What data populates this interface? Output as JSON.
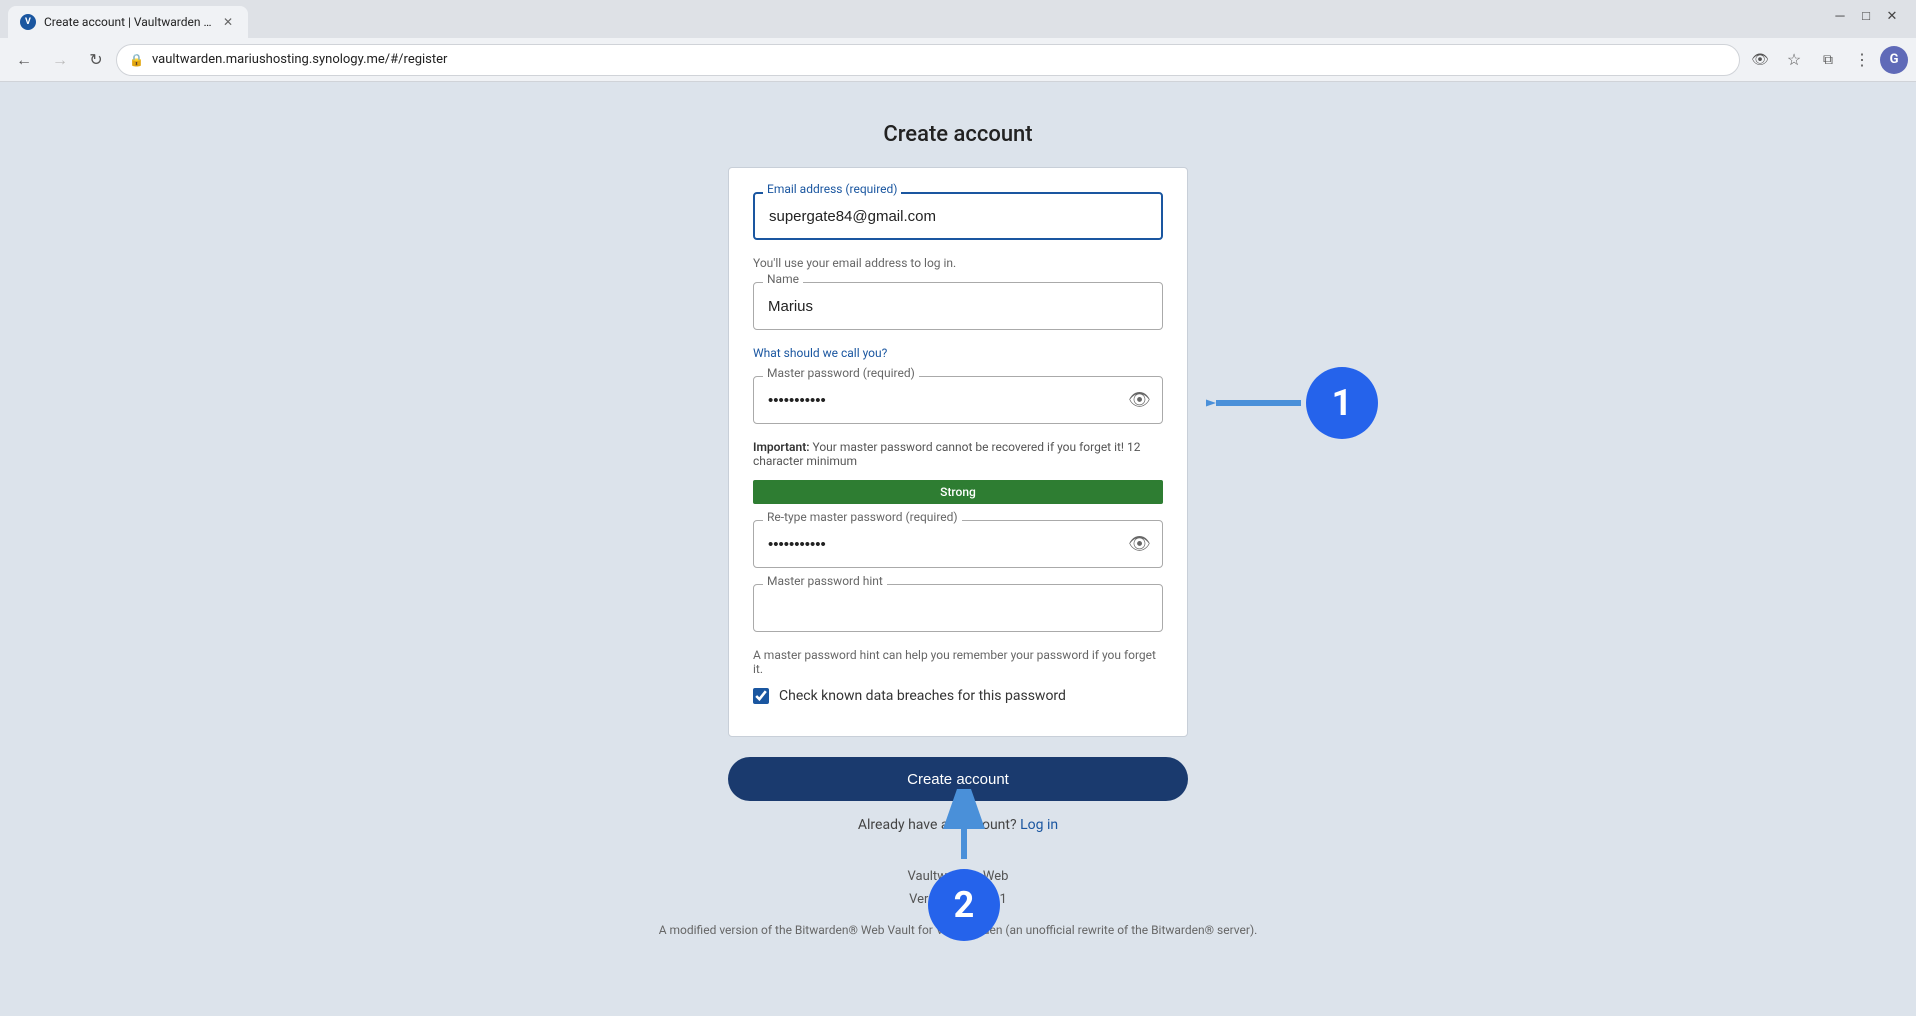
{
  "browser": {
    "tab_title": "Create account | Vaultwarden W",
    "tab_favicon": "V",
    "url": "vaultwarden.mariushosting.synology.me/#/register",
    "window_controls": {
      "minimize": "─",
      "restore": "□",
      "close": "✕"
    }
  },
  "nav": {
    "back_disabled": false,
    "forward_disabled": true,
    "profile_letter": "G"
  },
  "page": {
    "title": "Create account",
    "form": {
      "email_label": "Email address (required)",
      "email_value": "supergate84@gmail.com",
      "email_helper": "You'll use your email address to log in.",
      "name_label": "Name",
      "name_value": "Marius",
      "name_helper": "What should we call you?",
      "master_password_label": "Master password (required)",
      "master_password_value": "············",
      "master_password_warning": "Your master password cannot be recovered if you forget it! 12 character minimum",
      "master_password_warning_prefix": "Important:",
      "strength_label": "Strong",
      "strength_color": "#2e7d32",
      "retype_label": "Re-type master password (required)",
      "retype_value": "············",
      "hint_label": "Master password hint",
      "hint_value": "",
      "hint_helper": "A master password hint can help you remember your password if you forget it.",
      "breach_check_label": "Check known data breaches for this password",
      "breach_checked": true,
      "create_button": "Create account",
      "login_prompt": "Already have an account?",
      "login_link": "Log in"
    },
    "footer": {
      "line1": "Vaultwarden Web",
      "line2": "Version 2025.1.1",
      "line3": "A modified version of the Bitwarden® Web Vault for Vaultwarden (an unofficial rewrite of the Bitwarden® server)."
    },
    "annotations": {
      "badge1": "1",
      "badge2": "2"
    }
  }
}
